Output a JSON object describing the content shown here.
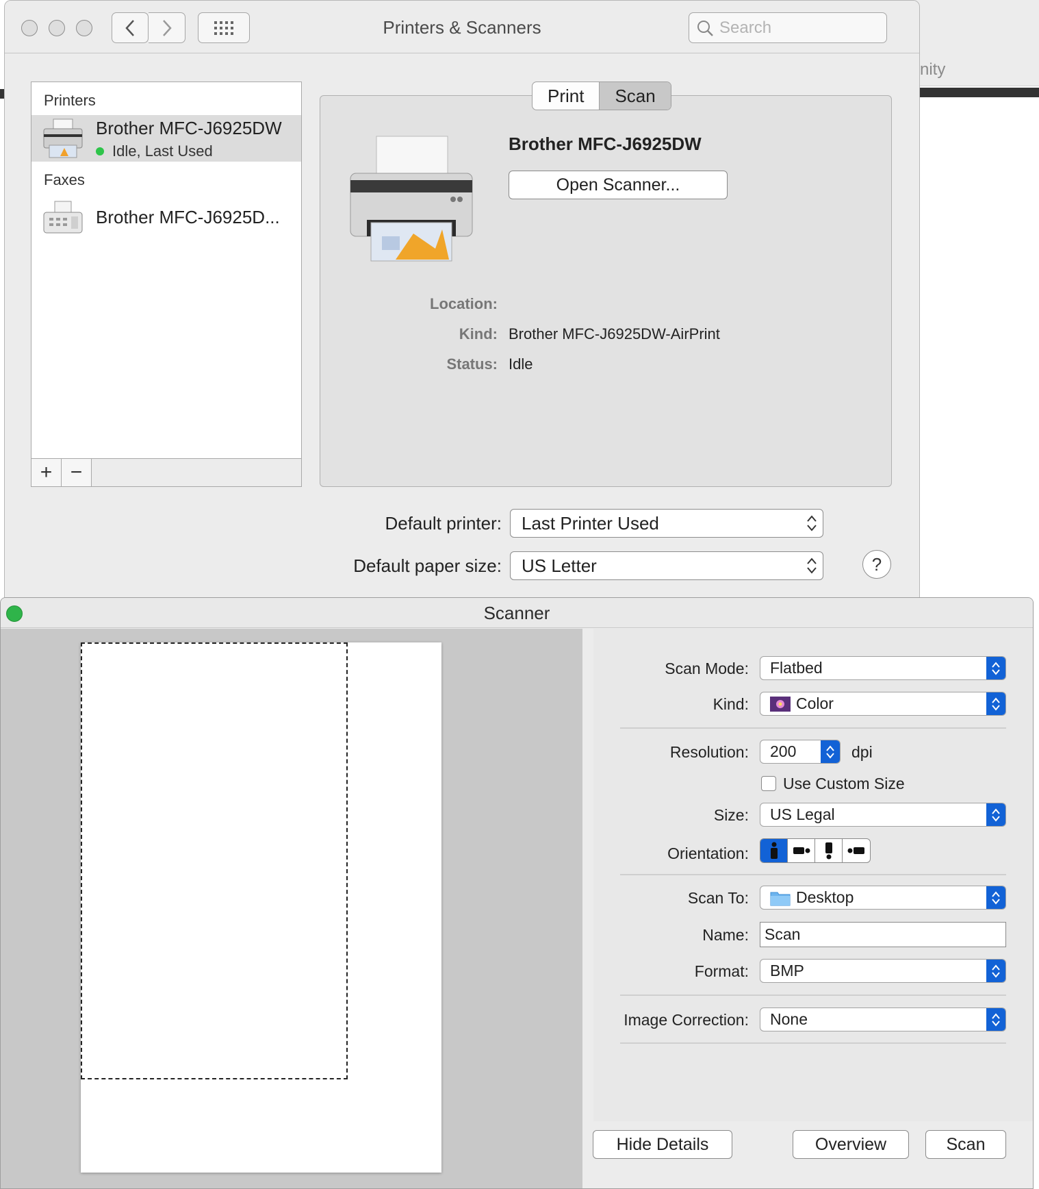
{
  "background_window": {
    "title_fragment": "nity"
  },
  "prefs_window": {
    "title": "Printers & Scanners",
    "search": {
      "placeholder": "Search",
      "value": ""
    }
  },
  "printer_list": {
    "printers_header": "Printers",
    "faxes_header": "Faxes",
    "printers": [
      {
        "name": "Brother MFC-J6925DW",
        "status": "Idle, Last Used",
        "status_color": "#2ec44a"
      }
    ],
    "faxes": [
      {
        "name": "Brother MFC-J6925D..."
      }
    ],
    "add_label": "+",
    "remove_label": "−"
  },
  "detail": {
    "tabs": [
      "Print",
      "Scan"
    ],
    "active_tab": "Scan",
    "device_name": "Brother MFC-J6925DW",
    "open_scanner_label": "Open Scanner...",
    "location_label": "Location:",
    "location_value": "",
    "kind_label": "Kind:",
    "kind_value": "Brother MFC-J6925DW-AirPrint",
    "status_label": "Status:",
    "status_value": "Idle"
  },
  "defaults": {
    "printer_label": "Default printer:",
    "printer_value": "Last Printer Used",
    "paper_label": "Default paper size:",
    "paper_value": "US Letter",
    "help_label": "?"
  },
  "scanner": {
    "title": "Scanner",
    "scan_mode_label": "Scan Mode:",
    "scan_mode_value": "Flatbed",
    "kind_label": "Kind:",
    "kind_value": "Color",
    "resolution_label": "Resolution:",
    "resolution_value": "200",
    "resolution_unit": "dpi",
    "custom_size_label": "Use Custom Size",
    "custom_size_checked": false,
    "size_label": "Size:",
    "size_value": "US Legal",
    "orientation_label": "Orientation:",
    "orientation_selected_index": 0,
    "scan_to_label": "Scan To:",
    "scan_to_value": "Desktop",
    "name_label": "Name:",
    "name_value": "Scan",
    "format_label": "Format:",
    "format_value": "BMP",
    "image_correction_label": "Image Correction:",
    "image_correction_value": "None",
    "hide_details_label": "Hide Details",
    "overview_label": "Overview",
    "scan_label": "Scan",
    "accent_color": "#1262d6"
  }
}
